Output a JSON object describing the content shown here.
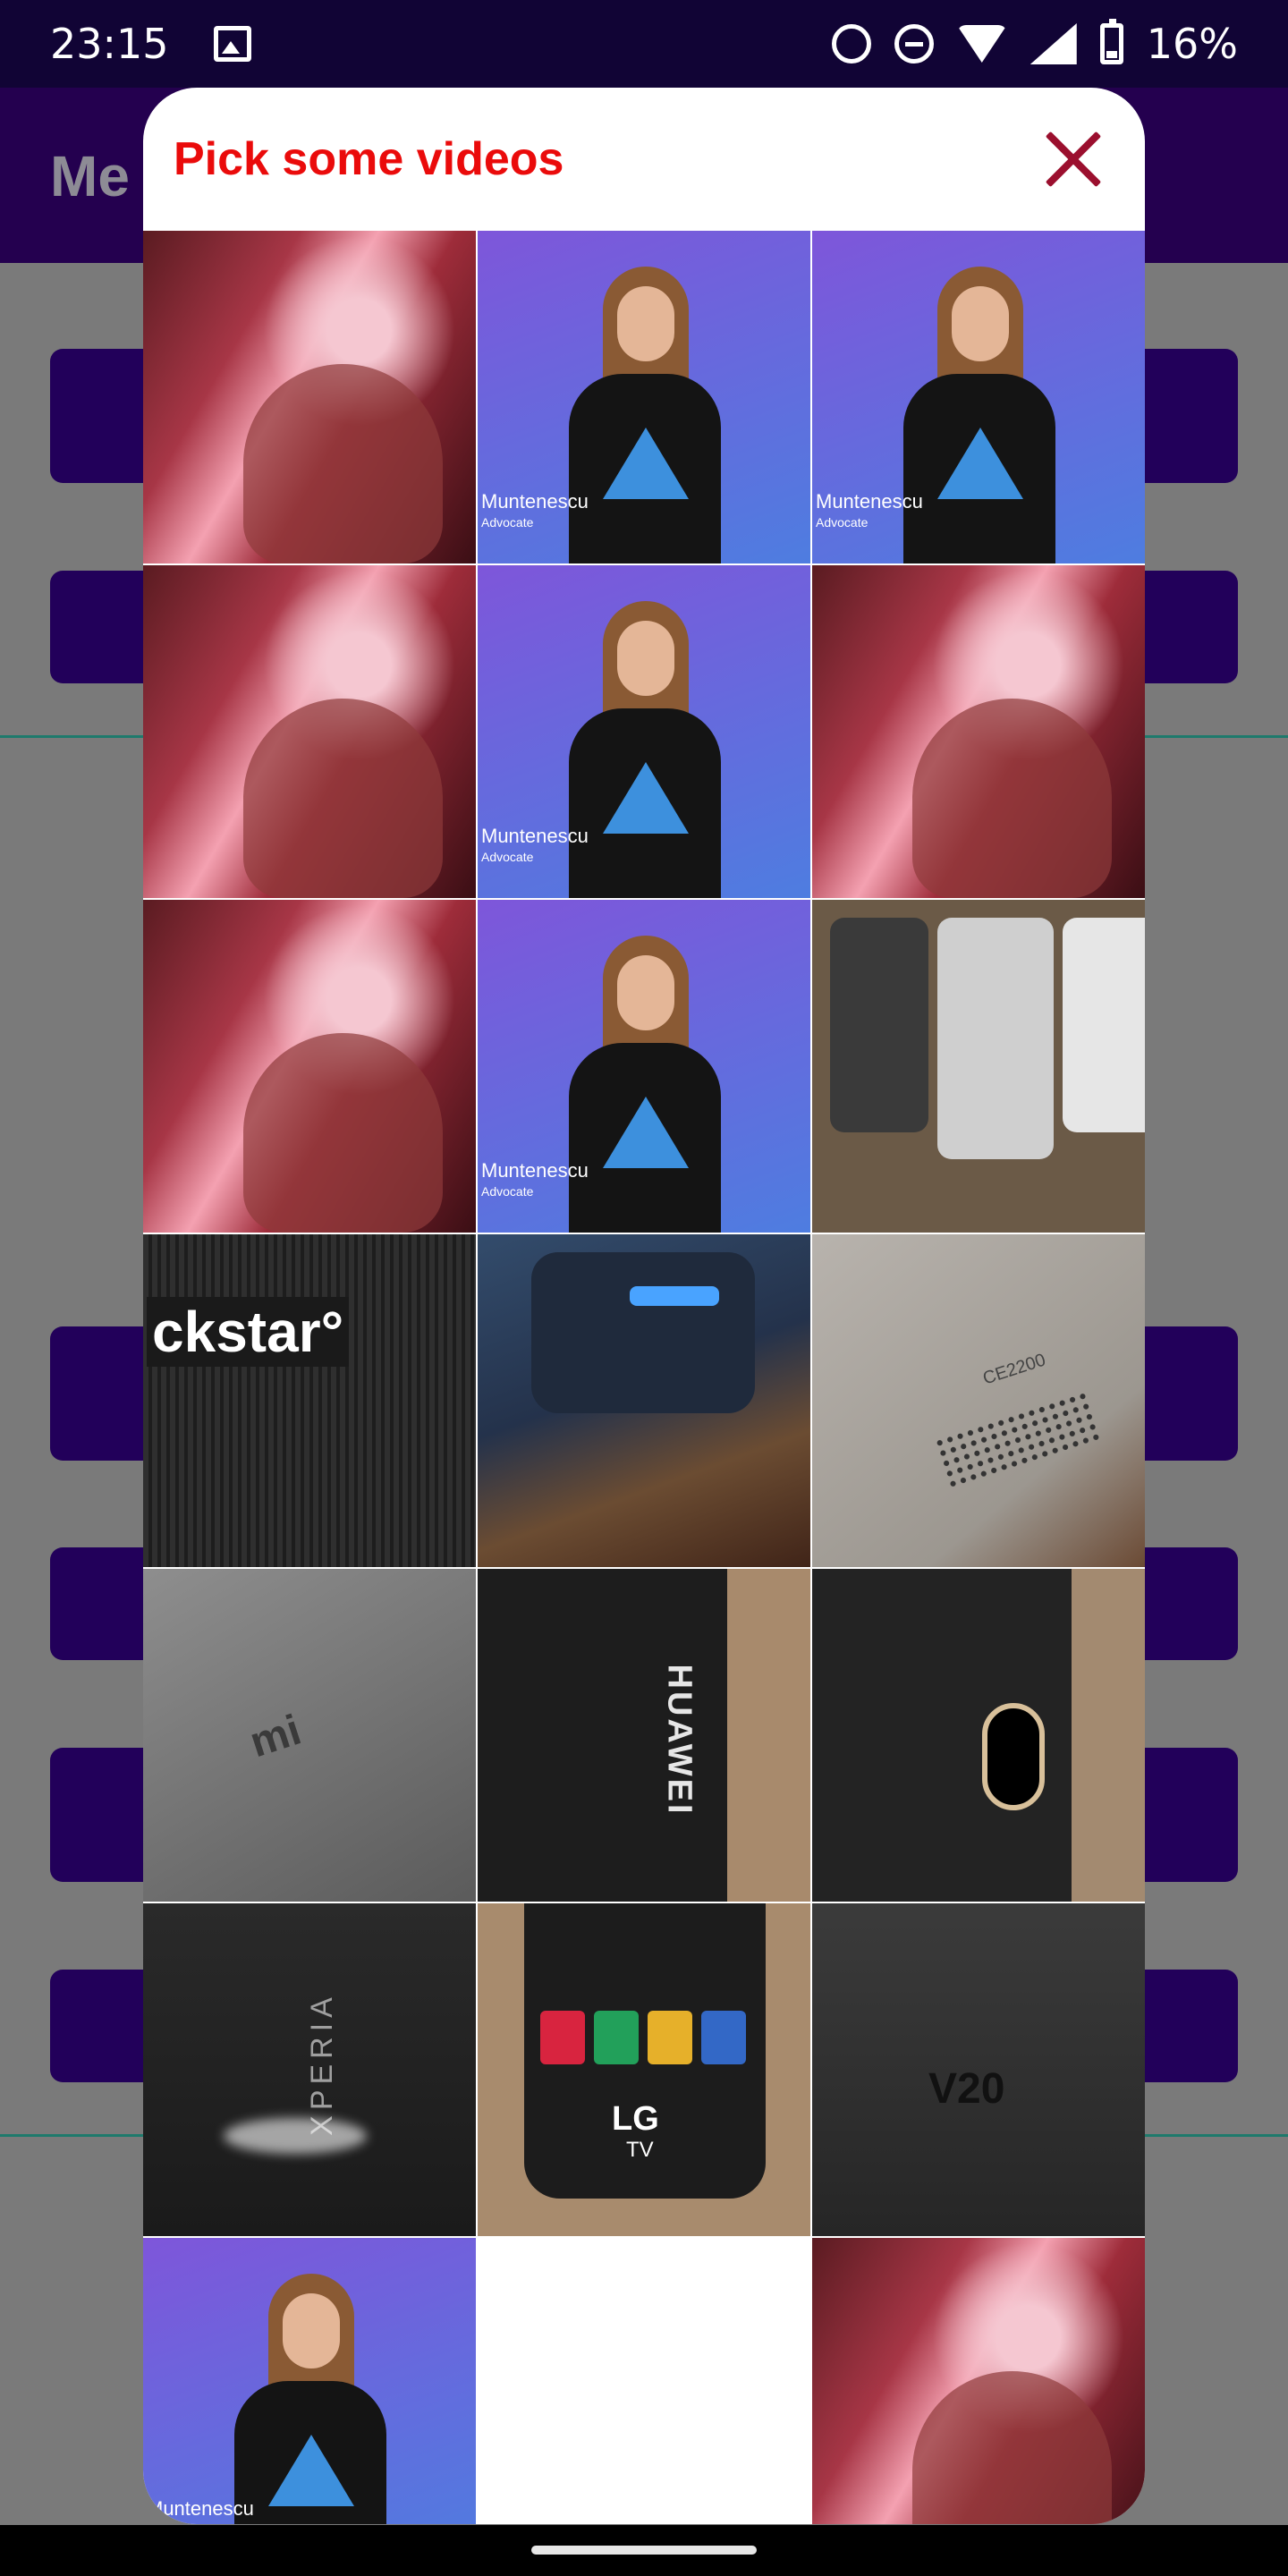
{
  "status_bar": {
    "time": "23:15",
    "battery": "16%",
    "icons": [
      "gallery-icon",
      "alarm-icon",
      "dnd-icon",
      "wifi-icon",
      "signal-icon",
      "battery-icon"
    ]
  },
  "background_app": {
    "title": "Me"
  },
  "dialog": {
    "title": "Pick some videos",
    "close_icon": "close-icon"
  },
  "grid": {
    "columns": 3,
    "thumbnails": [
      {
        "kind": "money"
      },
      {
        "kind": "presenter",
        "caption": "Muntenescu",
        "subcaption": "Advocate"
      },
      {
        "kind": "presenter",
        "caption": "Muntenescu",
        "subcaption": "Advocate"
      },
      {
        "kind": "money"
      },
      {
        "kind": "presenter",
        "caption": "Muntenescu",
        "subcaption": "Advocate"
      },
      {
        "kind": "money"
      },
      {
        "kind": "money"
      },
      {
        "kind": "presenter",
        "caption": "Muntenescu",
        "subcaption": "Advocate"
      },
      {
        "kind": "phones"
      },
      {
        "kind": "speaker",
        "text": "ckstar°"
      },
      {
        "kind": "charger"
      },
      {
        "kind": "phone-back",
        "text": "CE2200"
      },
      {
        "kind": "xiaomi",
        "text": "mi"
      },
      {
        "kind": "huawei",
        "text": "HUAWEI"
      },
      {
        "kind": "camera"
      },
      {
        "kind": "xperia",
        "text": "XPERIA"
      },
      {
        "kind": "remote",
        "text": "LG",
        "subtext": "TV"
      },
      {
        "kind": "v20",
        "text": "V20"
      },
      {
        "kind": "presenter",
        "caption": "Muntenescu",
        "subcaption": ""
      },
      {
        "kind": "blank"
      },
      {
        "kind": "money"
      }
    ]
  }
}
